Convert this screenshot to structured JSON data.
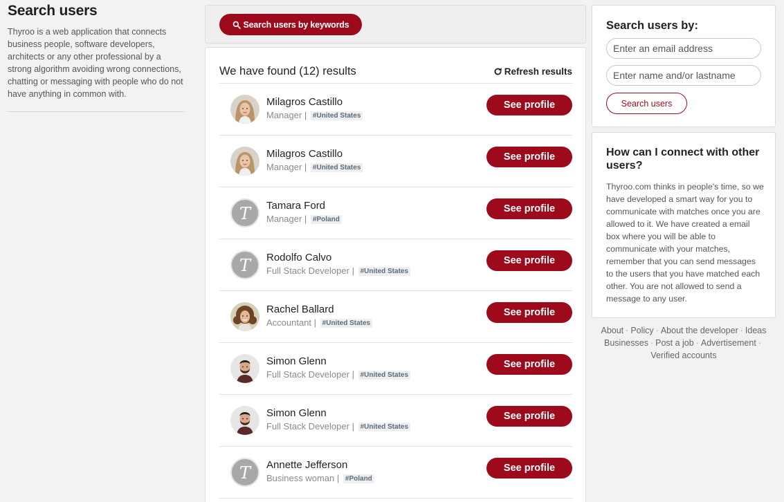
{
  "left": {
    "title": "Search users",
    "description": "Thyroo is a web application that connects business people, software developers, architects or any other professional by a strong algorithm avoiding wrong connections, chatting or messaging with people who do not have anything in common with."
  },
  "keyword_search": {
    "label": "Search users by keywords",
    "icon": "search-icon"
  },
  "results": {
    "title": "We have found (12) results",
    "refresh_label": "Refresh results",
    "see_profile_label": "See profile",
    "users": [
      {
        "name": "Milagros Castillo",
        "role": "Manager",
        "country": "#United States",
        "avatar": "woman-blonde"
      },
      {
        "name": "Milagros Castillo",
        "role": "Manager",
        "country": "#United States",
        "avatar": "woman-blonde"
      },
      {
        "name": "Tamara Ford",
        "role": "Manager",
        "country": "#Poland",
        "avatar": "T"
      },
      {
        "name": "Rodolfo Calvo",
        "role": "Full Stack Developer",
        "country": "#United States",
        "avatar": "T"
      },
      {
        "name": "Rachel Ballard",
        "role": "Accountant",
        "country": "#United States",
        "avatar": "woman-curly"
      },
      {
        "name": "Simon Glenn",
        "role": "Full Stack Developer",
        "country": "#United States",
        "avatar": "man-beard"
      },
      {
        "name": "Simon Glenn",
        "role": "Full Stack Developer",
        "country": "#United States",
        "avatar": "man-beard"
      },
      {
        "name": "Annette Jefferson",
        "role": "Business woman",
        "country": "#Poland",
        "avatar": "T"
      }
    ]
  },
  "search_by": {
    "title": "Search users by:",
    "email_placeholder": "Enter an email address",
    "name_placeholder": "Enter name and/or lastname",
    "button": "Search users"
  },
  "help": {
    "title": "How can I connect with other users?",
    "body": "Thyroo.com thinks in people's time, so we have developed a smart way for you to communicate with matches once you are allowed to it. We have created a email box where you will be able to communicate with your matches, remember that you can send messages to the users that you have matched each other. You are not allowed to send a message to any user."
  },
  "footer": {
    "links": [
      "About",
      "Policy",
      "About the developer",
      "Ideas",
      "Businesses",
      "Post a job",
      "Advertisement",
      "Verified accounts"
    ]
  },
  "colors": {
    "brand": "#9c0a1c",
    "background": "#f2f2f2"
  }
}
